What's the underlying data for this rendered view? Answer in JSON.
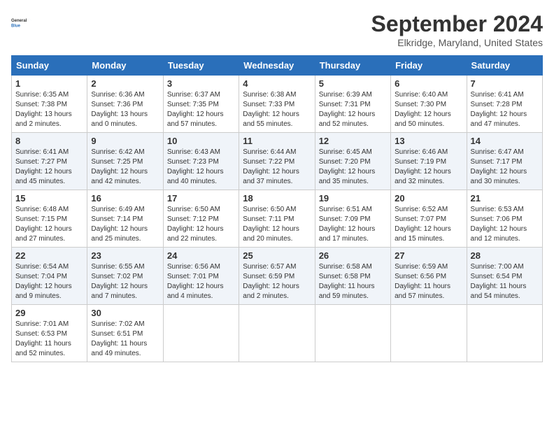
{
  "logo": {
    "line1": "General",
    "line2": "Blue"
  },
  "title": "September 2024",
  "subtitle": "Elkridge, Maryland, United States",
  "days_of_week": [
    "Sunday",
    "Monday",
    "Tuesday",
    "Wednesday",
    "Thursday",
    "Friday",
    "Saturday"
  ],
  "weeks": [
    [
      {
        "day": "1",
        "sunrise": "6:35 AM",
        "sunset": "7:38 PM",
        "daylight": "13 hours and 2 minutes."
      },
      {
        "day": "2",
        "sunrise": "6:36 AM",
        "sunset": "7:36 PM",
        "daylight": "13 hours and 0 minutes."
      },
      {
        "day": "3",
        "sunrise": "6:37 AM",
        "sunset": "7:35 PM",
        "daylight": "12 hours and 57 minutes."
      },
      {
        "day": "4",
        "sunrise": "6:38 AM",
        "sunset": "7:33 PM",
        "daylight": "12 hours and 55 minutes."
      },
      {
        "day": "5",
        "sunrise": "6:39 AM",
        "sunset": "7:31 PM",
        "daylight": "12 hours and 52 minutes."
      },
      {
        "day": "6",
        "sunrise": "6:40 AM",
        "sunset": "7:30 PM",
        "daylight": "12 hours and 50 minutes."
      },
      {
        "day": "7",
        "sunrise": "6:41 AM",
        "sunset": "7:28 PM",
        "daylight": "12 hours and 47 minutes."
      }
    ],
    [
      {
        "day": "8",
        "sunrise": "6:41 AM",
        "sunset": "7:27 PM",
        "daylight": "12 hours and 45 minutes."
      },
      {
        "day": "9",
        "sunrise": "6:42 AM",
        "sunset": "7:25 PM",
        "daylight": "12 hours and 42 minutes."
      },
      {
        "day": "10",
        "sunrise": "6:43 AM",
        "sunset": "7:23 PM",
        "daylight": "12 hours and 40 minutes."
      },
      {
        "day": "11",
        "sunrise": "6:44 AM",
        "sunset": "7:22 PM",
        "daylight": "12 hours and 37 minutes."
      },
      {
        "day": "12",
        "sunrise": "6:45 AM",
        "sunset": "7:20 PM",
        "daylight": "12 hours and 35 minutes."
      },
      {
        "day": "13",
        "sunrise": "6:46 AM",
        "sunset": "7:19 PM",
        "daylight": "12 hours and 32 minutes."
      },
      {
        "day": "14",
        "sunrise": "6:47 AM",
        "sunset": "7:17 PM",
        "daylight": "12 hours and 30 minutes."
      }
    ],
    [
      {
        "day": "15",
        "sunrise": "6:48 AM",
        "sunset": "7:15 PM",
        "daylight": "12 hours and 27 minutes."
      },
      {
        "day": "16",
        "sunrise": "6:49 AM",
        "sunset": "7:14 PM",
        "daylight": "12 hours and 25 minutes."
      },
      {
        "day": "17",
        "sunrise": "6:50 AM",
        "sunset": "7:12 PM",
        "daylight": "12 hours and 22 minutes."
      },
      {
        "day": "18",
        "sunrise": "6:50 AM",
        "sunset": "7:11 PM",
        "daylight": "12 hours and 20 minutes."
      },
      {
        "day": "19",
        "sunrise": "6:51 AM",
        "sunset": "7:09 PM",
        "daylight": "12 hours and 17 minutes."
      },
      {
        "day": "20",
        "sunrise": "6:52 AM",
        "sunset": "7:07 PM",
        "daylight": "12 hours and 15 minutes."
      },
      {
        "day": "21",
        "sunrise": "6:53 AM",
        "sunset": "7:06 PM",
        "daylight": "12 hours and 12 minutes."
      }
    ],
    [
      {
        "day": "22",
        "sunrise": "6:54 AM",
        "sunset": "7:04 PM",
        "daylight": "12 hours and 9 minutes."
      },
      {
        "day": "23",
        "sunrise": "6:55 AM",
        "sunset": "7:02 PM",
        "daylight": "12 hours and 7 minutes."
      },
      {
        "day": "24",
        "sunrise": "6:56 AM",
        "sunset": "7:01 PM",
        "daylight": "12 hours and 4 minutes."
      },
      {
        "day": "25",
        "sunrise": "6:57 AM",
        "sunset": "6:59 PM",
        "daylight": "12 hours and 2 minutes."
      },
      {
        "day": "26",
        "sunrise": "6:58 AM",
        "sunset": "6:58 PM",
        "daylight": "11 hours and 59 minutes."
      },
      {
        "day": "27",
        "sunrise": "6:59 AM",
        "sunset": "6:56 PM",
        "daylight": "11 hours and 57 minutes."
      },
      {
        "day": "28",
        "sunrise": "7:00 AM",
        "sunset": "6:54 PM",
        "daylight": "11 hours and 54 minutes."
      }
    ],
    [
      {
        "day": "29",
        "sunrise": "7:01 AM",
        "sunset": "6:53 PM",
        "daylight": "11 hours and 52 minutes."
      },
      {
        "day": "30",
        "sunrise": "7:02 AM",
        "sunset": "6:51 PM",
        "daylight": "11 hours and 49 minutes."
      },
      null,
      null,
      null,
      null,
      null
    ]
  ],
  "labels": {
    "sunrise": "Sunrise:",
    "sunset": "Sunset:",
    "daylight": "Daylight:"
  }
}
